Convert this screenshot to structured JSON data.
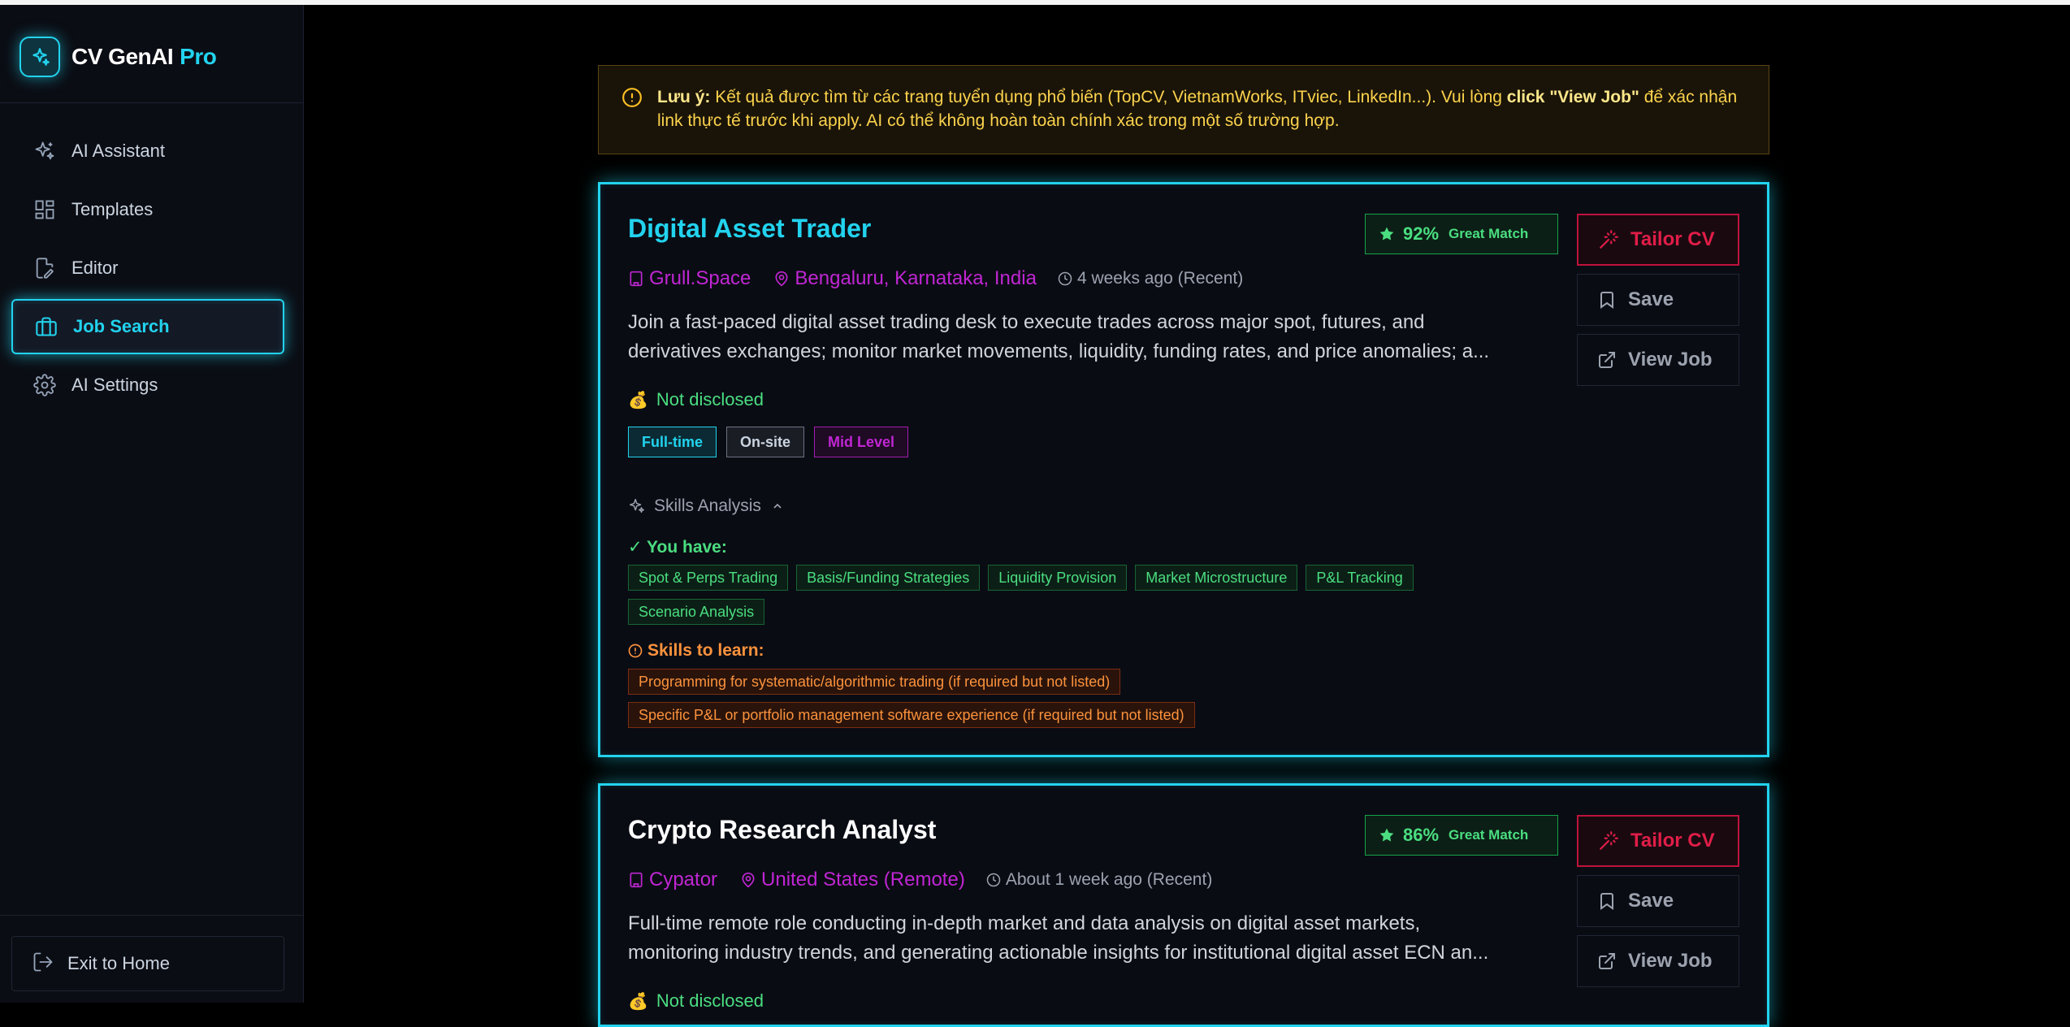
{
  "app": {
    "name": "CV GenAI",
    "badge": "Pro"
  },
  "sidebar": {
    "items": [
      {
        "label": "AI Assistant",
        "icon": "sparkles-icon"
      },
      {
        "label": "Templates",
        "icon": "grid-icon"
      },
      {
        "label": "Editor",
        "icon": "file-edit-icon"
      },
      {
        "label": "Job Search",
        "icon": "briefcase-icon",
        "active": true
      },
      {
        "label": "AI Settings",
        "icon": "gear-icon"
      }
    ],
    "exit_label": "Exit to Home"
  },
  "notice": {
    "prefix": "Lưu ý:",
    "text1": " Kết quả được tìm từ các trang tuyển dụng phổ biến (TopCV, VietnamWorks, ITviec, LinkedIn...). Vui lòng ",
    "emph": "click \"View Job\"",
    "text2": " để xác nhận link thực tế trước khi apply. AI có thể không hoàn toàn chính xác trong một số trường hợp."
  },
  "jobs": [
    {
      "title": "Digital Asset Trader",
      "company": "Grull.Space",
      "location": "Bengaluru, Karnataka, India",
      "posted": "4 weeks ago (Recent)",
      "desc_line1": "Join a fast-paced digital asset trading desk to execute trades across major spot, futures, and",
      "desc_line2": "derivatives exchanges; monitor market movements, liquidity, funding rates, and price anomalies; a...",
      "salary": "Not disclosed",
      "tags": {
        "type": "Full-time",
        "site": "On-site",
        "level": "Mid Level"
      },
      "match_pct": "92%",
      "match_label": "Great Match",
      "skills_title": "Skills Analysis",
      "have_title": "✓ You have:",
      "have": [
        "Spot & Perps Trading",
        "Basis/Funding Strategies",
        "Liquidity Provision",
        "Market Microstructure",
        "P&L Tracking",
        "Scenario Analysis"
      ],
      "learn_title": "Skills to learn:",
      "learn": [
        "Programming for systematic/algorithmic trading (if required but not listed)",
        "Specific P&L or portfolio management software experience (if required but not listed)"
      ]
    },
    {
      "title": "Crypto Research Analyst",
      "company": "Cypator",
      "location": "United States (Remote)",
      "posted": "About 1 week ago (Recent)",
      "desc_line1": "Full-time remote role conducting in-depth market and data analysis on digital asset markets,",
      "desc_line2": "monitoring industry trends, and generating actionable insights for institutional digital asset ECN an...",
      "salary": "Not disclosed",
      "match_pct": "86%",
      "match_label": "Great Match"
    }
  ],
  "actions": {
    "tailor": "Tailor CV",
    "save": "Save",
    "view": "View Job"
  },
  "colors": {
    "accent": "#22d3ee",
    "magenta": "#c026d3",
    "green": "#4ade80",
    "orange": "#fb923c",
    "rose": "#e11d48"
  }
}
